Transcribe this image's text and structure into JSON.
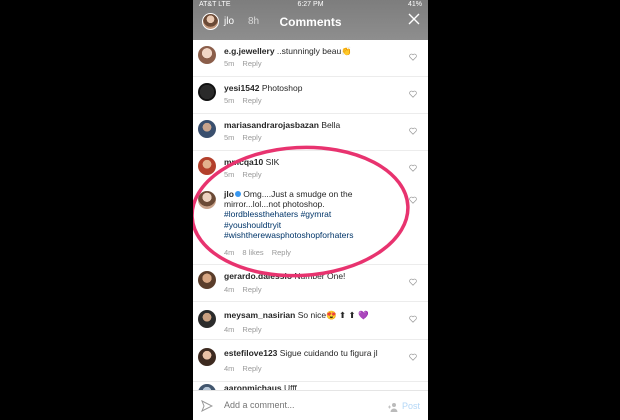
{
  "status_bar": {
    "carrier": "AT&T  LTE",
    "time": "6:27 PM",
    "battery": "41%"
  },
  "header": {
    "title": "Comments",
    "story_user": "jlo",
    "story_age": "8h"
  },
  "comments": [
    {
      "username": "e.g.jewellery",
      "text": " ..stunningly beau👏",
      "time": "5m",
      "reply": "Reply"
    },
    {
      "username": "yesi1542",
      "text": " Photoshop",
      "time": "5m",
      "reply": "Reply"
    },
    {
      "username": "mariasandrarojasbazan",
      "text": " Bella",
      "time": "5m",
      "reply": "Reply"
    },
    {
      "username": "mmcqa10",
      "text": " SIK",
      "time": "5m",
      "reply": "Reply"
    },
    {
      "username": "jlo",
      "verified": true,
      "text": " Omg....Just a smudge on the mirror...lol...not photoshop.",
      "hashtags": [
        "#lordblessthehaters",
        "#gymrat",
        "#youshouldtryit",
        "#wishtherewasphotoshopforhaters"
      ],
      "time": "4m",
      "likes": "8 likes",
      "reply": "Reply"
    },
    {
      "username": "gerardo.dalessio",
      "text": " Number One!",
      "time": "4m",
      "reply": "Reply"
    },
    {
      "username": "meysam_nasirian",
      "text": " So nice😍 ⬆ ⬆ 💜",
      "time": "4m",
      "reply": "Reply"
    },
    {
      "username": "estefilove123",
      "text": " Sigue cuidando tu figura jl",
      "time": "4m",
      "reply": "Reply"
    },
    {
      "username": "aaronmichaus",
      "text": " Ufff"
    }
  ],
  "composer": {
    "placeholder": "Add a comment...",
    "post_label": "Post"
  },
  "colors": {
    "highlight": "#e8336f",
    "link": "#003569",
    "post": "#b4d7f7"
  },
  "icons": {
    "heart": "heart-icon",
    "close": "close-icon",
    "send": "direct-send-icon",
    "add_user": "add-user-icon"
  }
}
